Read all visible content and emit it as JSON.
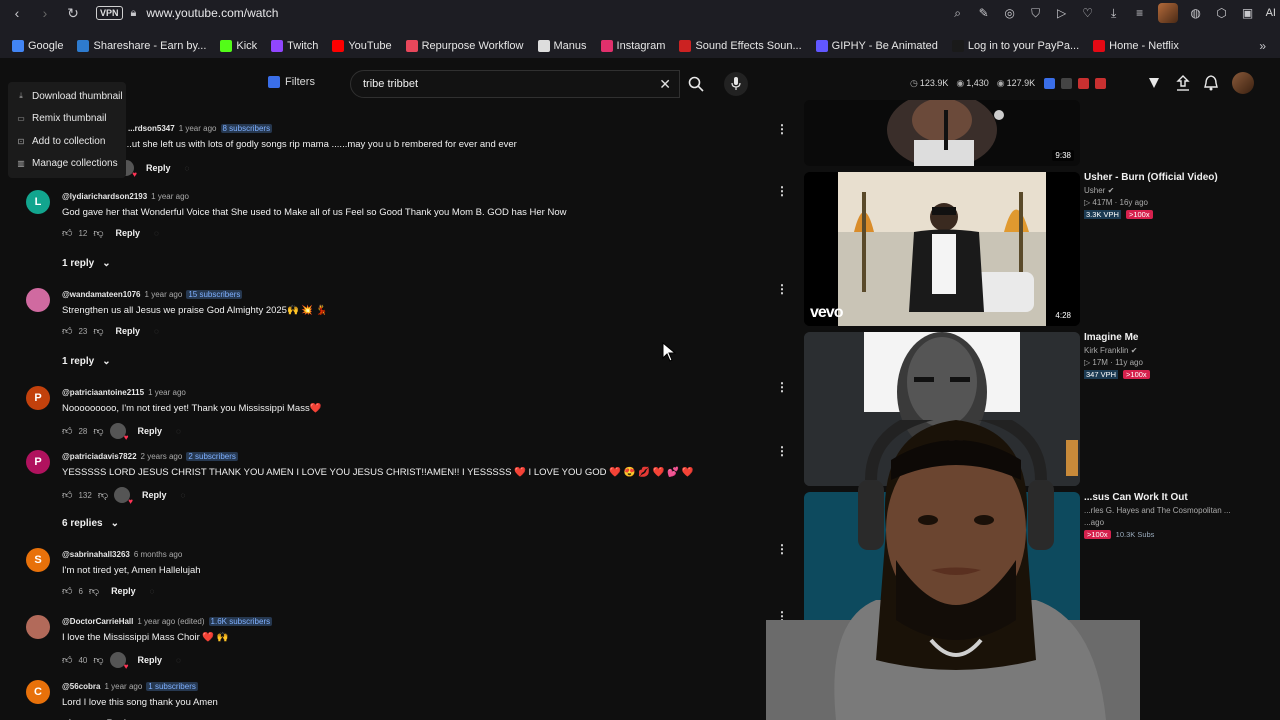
{
  "browser": {
    "url": "www.youtube.com/watch",
    "vpn_label": "VPN",
    "ai_label": "AI",
    "bookmarks": [
      {
        "label": "Google",
        "color": "#4285f4"
      },
      {
        "label": "Shareshare - Earn by...",
        "color": "#2e7bcf"
      },
      {
        "label": "Kick",
        "color": "#53fc18"
      },
      {
        "label": "Twitch",
        "color": "#9146ff"
      },
      {
        "label": "YouTube",
        "color": "#ff0000"
      },
      {
        "label": "Repurpose Workflow",
        "color": "#e8475b"
      },
      {
        "label": "Manus",
        "color": "#dddddd"
      },
      {
        "label": "Instagram",
        "color": "#e1306c"
      },
      {
        "label": "Sound Effects Soun...",
        "color": "#cc2222"
      },
      {
        "label": "GIPHY - Be Animated",
        "color": "#6157ff"
      },
      {
        "label": "Log in to your PayPa...",
        "color": "#1a1a1a"
      },
      {
        "label": "Home - Netflix",
        "color": "#e50914"
      }
    ]
  },
  "header": {
    "filters_label": "Filters",
    "search_value": "tribe tribbet",
    "stats": [
      "123.9K",
      "1,430",
      "127.9K"
    ]
  },
  "context_menu": {
    "items": [
      "Download thumbnail",
      "Remix thumbnail",
      "Add to collection",
      "Manage collections"
    ]
  },
  "comments": [
    {
      "author": "...rdson5347",
      "time": "1 year ago",
      "subs": "8 subscribers",
      "text": "...ut she left us with lots of godly songs rip mama ......may you  u b rembered for ever and ever",
      "likes": "",
      "avatar_letter": "",
      "avatar_color": "#333"
    },
    {
      "author": "@lydiarichardson2193",
      "time": "1 year ago",
      "subs": "",
      "text": "God gave her that Wonderful Voice that She used to Make all of us Feel so Good Thank you Mom B. GOD has Her Now",
      "likes": "12",
      "avatar_letter": "L",
      "avatar_color": "#12a58e",
      "replies": "1 reply"
    },
    {
      "author": "@wandamateen1076",
      "time": "1 year ago",
      "subs": "15 subscribers",
      "text": "Strengthen us all Jesus we praise God Almighty 2025🙌 💥 💃",
      "likes": "23",
      "avatar_letter": "",
      "avatar_color": "#d06aa0",
      "replies": "1 reply"
    },
    {
      "author": "@patriciaantoine2115",
      "time": "1 year ago",
      "subs": "",
      "text": "Nooooooooo, I'm not tired yet! Thank you Mississippi Mass❤️",
      "likes": "28",
      "avatar_letter": "P",
      "avatar_color": "#c2410c"
    },
    {
      "author": "@patriciadavis7822",
      "time": "2 years ago",
      "subs": "2 subscribers",
      "text": "YESSSSS LORD JESUS CHRIST THANK YOU AMEN  I LOVE YOU JESUS CHRIST!!AMEN!! I YESSSSS ❤️ I LOVE YOU GOD ❤️ 😍 💋 ❤️ 💕 ❤️",
      "likes": "132",
      "avatar_letter": "P",
      "avatar_color": "#b0125e",
      "replies": "6 replies"
    },
    {
      "author": "@sabrinahall3263",
      "time": "6 months ago",
      "subs": "",
      "text": "I'm not tired yet, Amen Hallelujah",
      "likes": "6",
      "avatar_letter": "S",
      "avatar_color": "#e8710a"
    },
    {
      "author": "@DoctorCarrieHall",
      "time": "1 year ago (edited)",
      "subs": "1.6K subscribers",
      "text": "I love the Mississippi Mass Choir ❤️ 🙌",
      "likes": "40",
      "avatar_letter": "",
      "avatar_color": "#b26a5a"
    },
    {
      "author": "@56cobra",
      "time": "1 year ago",
      "subs": "1 subscribers",
      "text": "Lord I love this song thank you Amen",
      "likes": "",
      "avatar_letter": "C",
      "avatar_color": "#e8710a"
    }
  ],
  "reply_label": "Reply",
  "videos": [
    {
      "title": "",
      "channel": "",
      "meta": "",
      "vph": "",
      "pct": "",
      "duration": "9:38"
    },
    {
      "title": "Usher - Burn (Official Video)",
      "channel": "Usher",
      "meta": "417M · 16y ago",
      "vph": "3.3K VPH",
      "pct": ">100x",
      "duration": "4:28",
      "brand": "vevo"
    },
    {
      "title": "Imagine Me",
      "channel": "Kirk Franklin",
      "meta": "17M · 11y ago",
      "vph": "347 VPH",
      "pct": ">100x",
      "duration": ""
    },
    {
      "title": "...sus Can Work It Out",
      "channel": "...rles G. Hayes and The Cosmopolitan ...",
      "meta": "...ago",
      "vph": "",
      "pct": ">100x",
      "subs": "10.3K Subs",
      "duration": ""
    }
  ]
}
